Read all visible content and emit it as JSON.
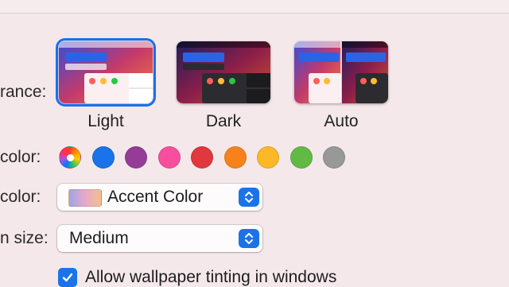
{
  "appearance": {
    "label": "rance:",
    "options": [
      {
        "label": "Light",
        "selected": true
      },
      {
        "label": "Dark",
        "selected": false
      },
      {
        "label": "Auto",
        "selected": false
      }
    ]
  },
  "accent": {
    "label": "color:",
    "colors": [
      {
        "name": "multicolor",
        "hex": "multicolor"
      },
      {
        "name": "blue",
        "hex": "#1a73e8"
      },
      {
        "name": "purple",
        "hex": "#953d96"
      },
      {
        "name": "pink",
        "hex": "#f74f9e"
      },
      {
        "name": "red",
        "hex": "#e0383e"
      },
      {
        "name": "orange",
        "hex": "#f7821b"
      },
      {
        "name": "yellow",
        "hex": "#fcb827"
      },
      {
        "name": "green",
        "hex": "#62ba46"
      },
      {
        "name": "graphite",
        "hex": "#989898"
      }
    ],
    "selected": "multicolor"
  },
  "highlight": {
    "label": "color:",
    "value": "Accent Color"
  },
  "sidebar_icon_size": {
    "label": "n size:",
    "value": "Medium"
  },
  "wallpaper_tinting": {
    "label": "Allow wallpaper tinting in windows",
    "checked": true
  },
  "colors": {
    "accent_blue": "#1a73e8",
    "background": "#f4e8ea"
  }
}
